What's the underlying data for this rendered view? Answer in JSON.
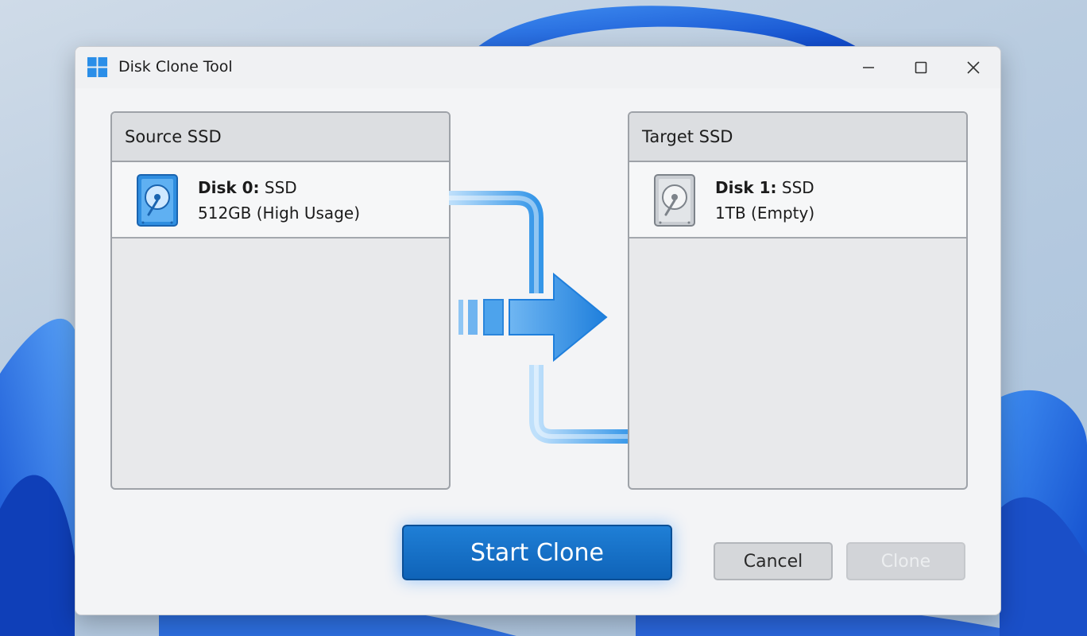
{
  "window": {
    "title": "Disk Clone Tool"
  },
  "source": {
    "header": "Source SSD",
    "disk_name": "Disk 0:",
    "disk_type": "SSD",
    "disk_details": "512GB (High Usage)",
    "icon": "hard-drive-icon",
    "accent": "#2f8ee0"
  },
  "target": {
    "header": "Target SSD",
    "disk_name": "Disk 1:",
    "disk_type": "SSD",
    "disk_details": "1TB (Empty)",
    "icon": "hard-drive-icon",
    "accent": "#9aa0a6"
  },
  "actions": {
    "start": "Start Clone",
    "cancel": "Cancel",
    "clone": "Clone"
  },
  "colors": {
    "primary": "#1570c8",
    "arrow": "#3596e8"
  }
}
